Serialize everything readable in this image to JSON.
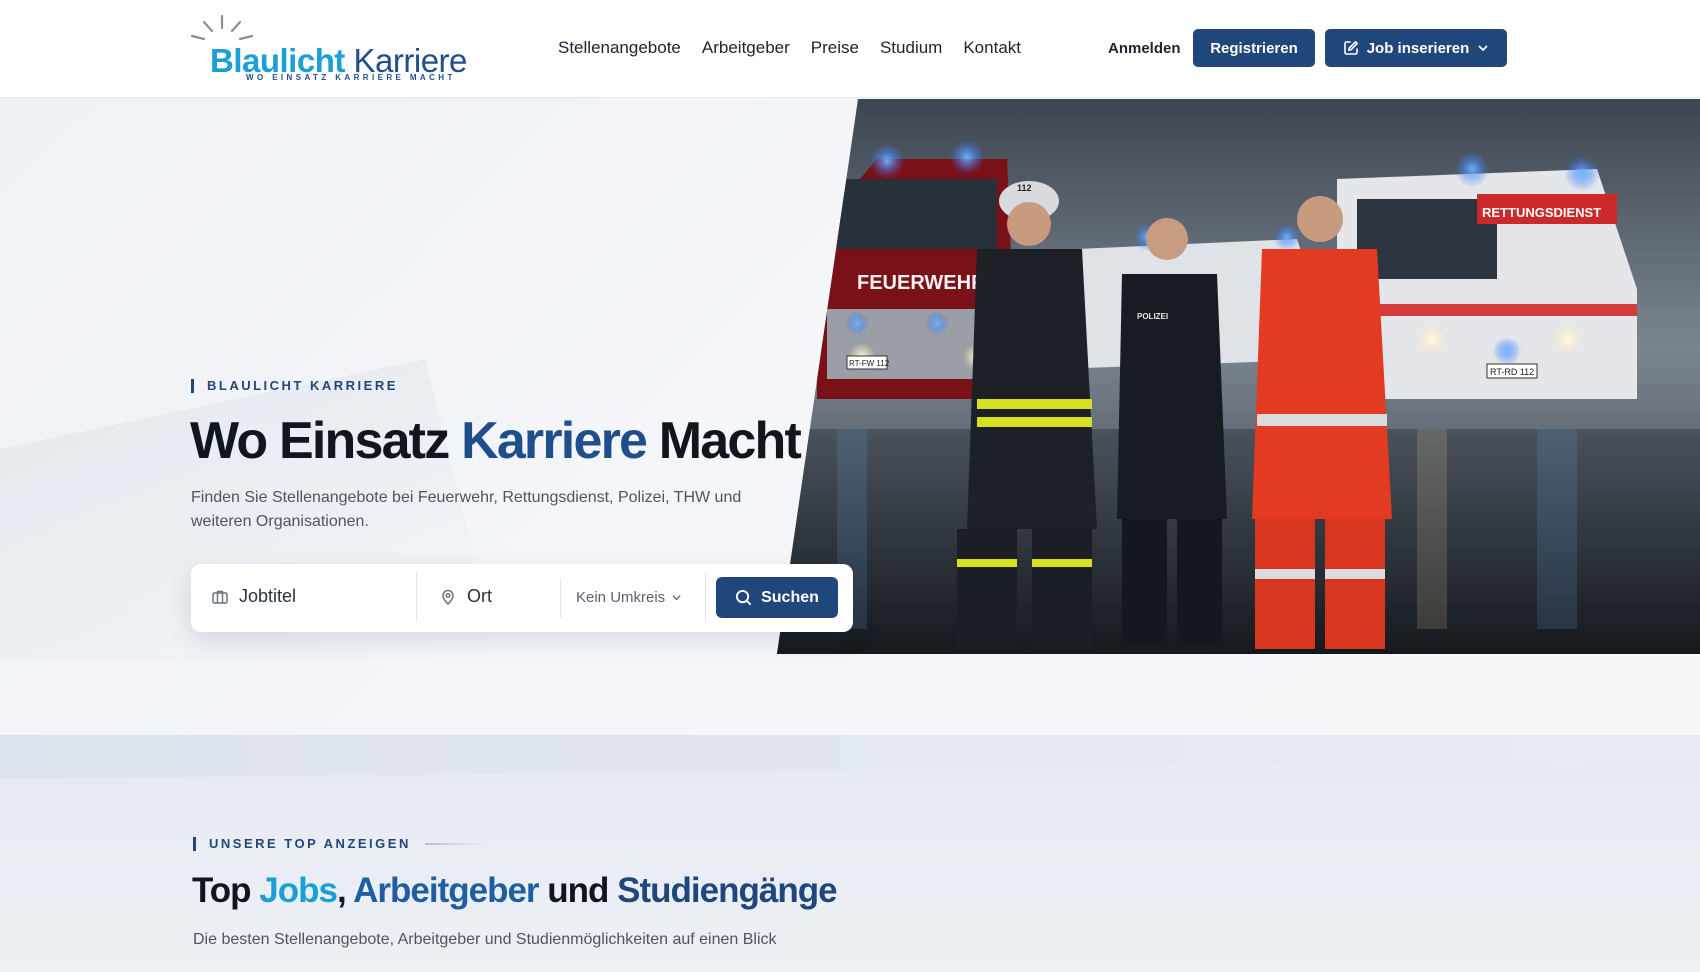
{
  "brand": {
    "name_part1": "Blaulicht",
    "name_part2": "Karriere",
    "tagline": "WO EINSATZ KARRIERE MACHT"
  },
  "nav": {
    "items": [
      {
        "label": "Stellenangebote"
      },
      {
        "label": "Arbeitgeber"
      },
      {
        "label": "Preise"
      },
      {
        "label": "Studium"
      },
      {
        "label": "Kontakt"
      }
    ],
    "login_label": "Anmelden",
    "register_label": "Registrieren",
    "post_job_label": "Job inserieren"
  },
  "hero": {
    "eyebrow": "BLAULICHT KARRIERE",
    "title_part1": "Wo Einsatz ",
    "title_accent": "Karriere",
    "title_part2": " Macht",
    "subtitle": "Finden Sie Stellenangebote bei Feuerwehr, Rettungsdienst, Polizei, THW und weiteren Organisationen.",
    "image_alt": "Feuerwehrmann, Polizistin und Rettungssanitäter vor Einsatzfahrzeugen",
    "photo_text": {
      "fire_truck": "FEUERWEHR",
      "ambulance": "RETTUNGSDIENST",
      "police_badge": "POLIZEI",
      "helmet_number": "112",
      "plate_fire": "RT-FW 112",
      "plate_ambulance": "RT-RD 112"
    }
  },
  "search": {
    "job_placeholder": "Jobtitel",
    "location_placeholder": "Ort",
    "radius_value": "Kein Umkreis",
    "submit_label": "Suchen"
  },
  "top_section": {
    "eyebrow": "UNSERE TOP ANZEIGEN",
    "title_part1": "Top ",
    "title_jobs": "Jobs",
    "title_sep": ", ",
    "title_employers": "Arbeitgeber",
    "title_and": " und ",
    "title_studies": "Studiengänge",
    "subtitle": "Die besten Stellenangebote, Arbeitgeber und Studienmöglichkeiten auf einen Blick"
  },
  "colors": {
    "primary": "#1f477c",
    "accent_light": "#1a9fd6",
    "text": "#0f1620"
  }
}
